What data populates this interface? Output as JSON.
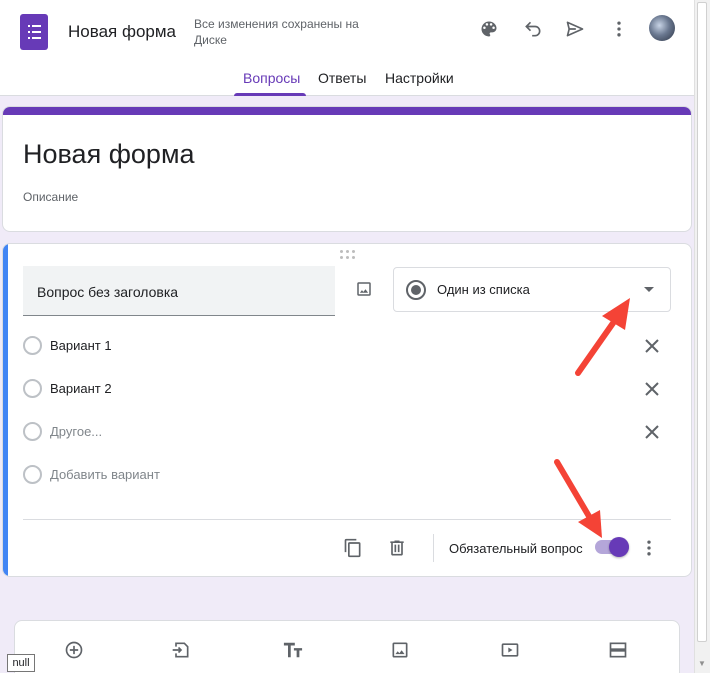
{
  "header": {
    "doc_title": "Новая форма",
    "save_status": "Все изменения сохранены на Диске",
    "icons": [
      "palette-icon",
      "undo-icon",
      "send-icon",
      "more-vert-icon",
      "avatar"
    ]
  },
  "tabs": [
    {
      "label": "Вопросы",
      "active": true
    },
    {
      "label": "Ответы",
      "active": false
    },
    {
      "label": "Настройки",
      "active": false
    }
  ],
  "form": {
    "title": "Новая форма",
    "description_placeholder": "Описание",
    "accent_color": "#673ab7"
  },
  "question": {
    "title": "Вопрос без заголовка",
    "type": "Один из списка",
    "options": [
      {
        "label": "Вариант 1"
      },
      {
        "label": "Вариант 2"
      },
      {
        "label": "Другое..."
      }
    ],
    "add_option": "Добавить вариант",
    "required_label": "Обязательный вопрос",
    "required_on": true
  },
  "toolbar": {
    "items": [
      "add-question-icon",
      "import-questions-icon",
      "add-title-icon",
      "add-image-icon",
      "add-video-icon",
      "add-section-icon"
    ]
  },
  "tooltip": {
    "text": "null"
  },
  "annotation_color": "#f44336"
}
